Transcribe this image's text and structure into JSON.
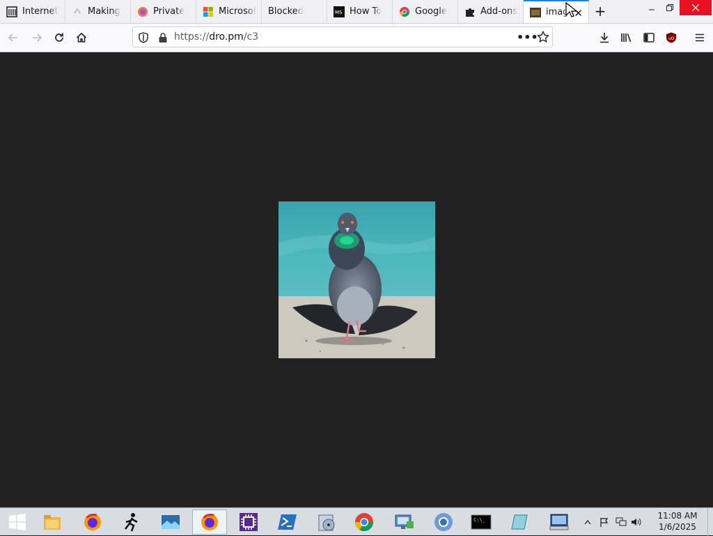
{
  "browser": {
    "tabs": [
      {
        "title": "Internet",
        "icon": "archive-icon"
      },
      {
        "title": "Making",
        "icon": "wordpress-icon"
      },
      {
        "title": "Private",
        "icon": "firefox-icon"
      },
      {
        "title": "Microsof",
        "icon": "microsoft-icon"
      },
      {
        "title": "Blocked",
        "icon": "none"
      },
      {
        "title": "How To",
        "icon": "ms-icon"
      },
      {
        "title": "Google",
        "icon": "google-icon"
      },
      {
        "title": "Add-ons",
        "icon": "puzzle-icon"
      },
      {
        "title": "imag",
        "icon": "image-icon"
      }
    ],
    "new_tab": "+",
    "url": {
      "prefix": "https://",
      "host": "dro.pm",
      "path": "/c3"
    },
    "colors": {
      "accent": "#0a84ff",
      "content_bg": "#222222"
    }
  },
  "taskbar": {
    "clock": {
      "time": "11:08 AM",
      "date": "1/6/2025"
    },
    "apps": [
      "start-icon",
      "file-explorer-icon",
      "firefox-icon",
      "runner-icon",
      "photos-icon",
      "firefox-icon",
      "chip-icon",
      "powershell-icon",
      "disk-icon",
      "chrome-icon",
      "network-icon",
      "chromium-icon",
      "terminal-icon",
      "notepad-icon",
      "remote-desktop-icon"
    ]
  }
}
